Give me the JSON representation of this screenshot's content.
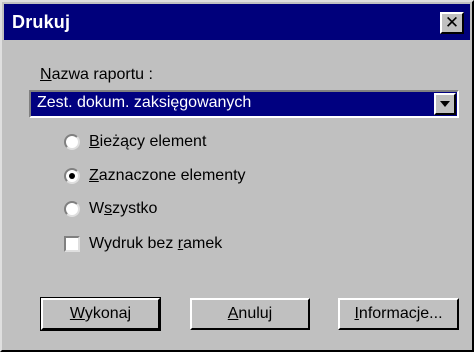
{
  "window": {
    "title": "Drukuj",
    "close_glyph": "✕"
  },
  "report": {
    "label": "Nazwa raportu :",
    "label_rest": "azwa raportu :",
    "label_mnemonic": "N",
    "selected_value": "Zest. dokum. zaksięgowanych"
  },
  "options": [
    {
      "mnemonic": "B",
      "rest": "ieżący element",
      "label": "Bieżący element",
      "checked": false
    },
    {
      "mnemonic": "Z",
      "rest": "aznaczone elementy",
      "label": "Zaznaczone elementy",
      "checked": true
    },
    {
      "pre": "W",
      "mnemonic": "s",
      "rest": "zystko",
      "label": "Wszystko",
      "checked": false
    }
  ],
  "checkbox": {
    "pre": "Wydruk bez ",
    "mnemonic": "r",
    "rest": "amek",
    "label": "Wydruk bez ramek",
    "checked": false
  },
  "buttons": {
    "execute": {
      "mnemonic": "W",
      "rest": "ykonaj",
      "label": "Wykonaj"
    },
    "cancel": {
      "mnemonic": "A",
      "rest": "nuluj",
      "label": "Anuluj"
    },
    "info": {
      "mnemonic": "I",
      "rest": "nformacje...",
      "label": "Informacje..."
    }
  }
}
